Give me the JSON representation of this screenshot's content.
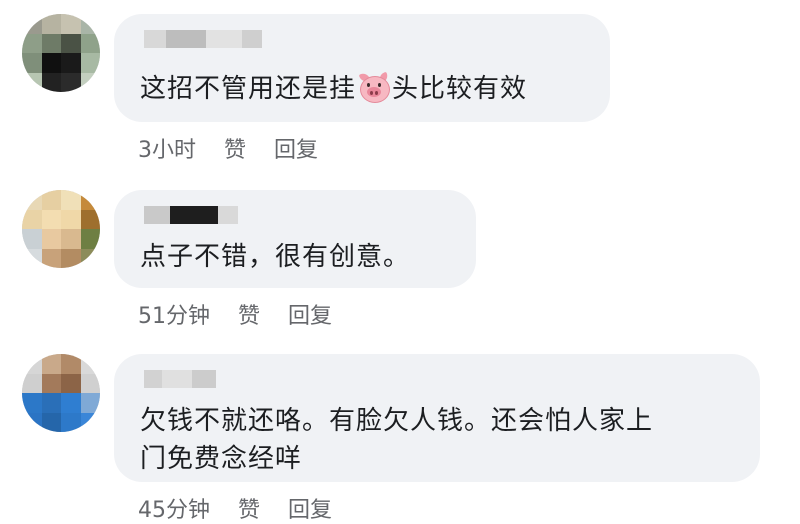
{
  "comments": [
    {
      "text_before_emoji": "这招不管用还是挂",
      "emoji": "pig-face-emoji",
      "text_after_emoji": "头比较有效",
      "time": "3小时",
      "like_label": "赞",
      "reply_label": "回复"
    },
    {
      "text": "点子不错，很有创意。",
      "time": "51分钟",
      "like_label": "赞",
      "reply_label": "回复"
    },
    {
      "text_line1": "欠钱不就还咯。有脸欠人钱。还会怕人家上",
      "text_line2": "门免费念经咩",
      "time": "45分钟",
      "like_label": "赞",
      "reply_label": "回复"
    }
  ],
  "colors": {
    "bubble": "#f0f2f5",
    "text": "#1c1e21",
    "meta": "#65676b"
  }
}
